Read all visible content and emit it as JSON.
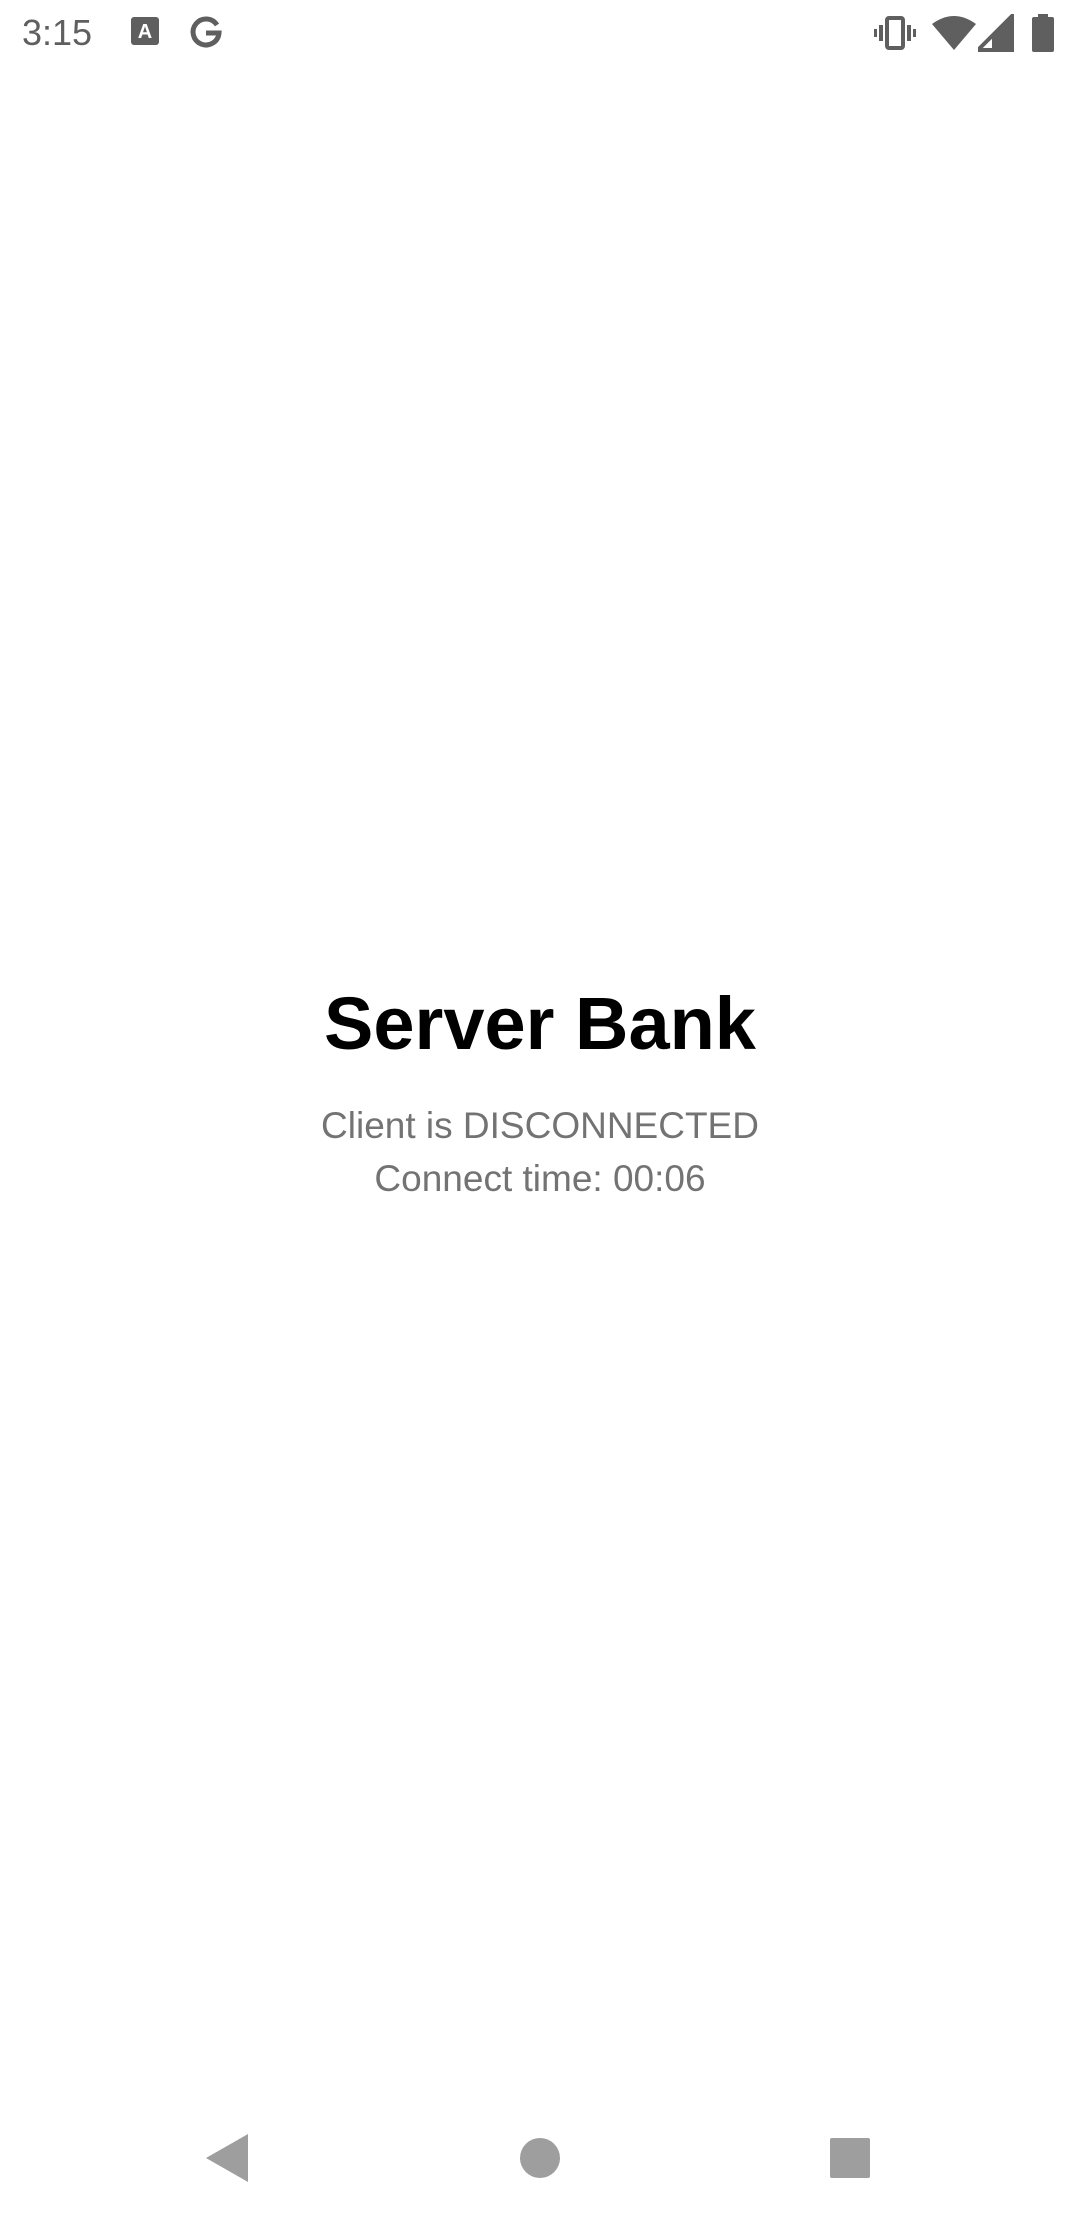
{
  "status_bar": {
    "time": "3:15",
    "notification_icons": [
      "text-recognition-icon",
      "google-icon"
    ],
    "system_icons": [
      "vibrate-icon",
      "wifi-icon",
      "cellular-signal-icon",
      "battery-icon"
    ],
    "google_glyph": "G",
    "a_glyph": "A"
  },
  "main": {
    "title": "Server Bank",
    "client_status": "Client is DISCONNECTED",
    "connect_time": "Connect time: 00:06"
  },
  "nav_bar": {
    "buttons": [
      "back-button",
      "home-button",
      "recents-button"
    ]
  },
  "colors": {
    "background": "#ffffff",
    "title": "#000000",
    "secondary_text": "#737373",
    "icon_gray": "#5f5f5f",
    "nav_gray": "#9e9e9e"
  }
}
